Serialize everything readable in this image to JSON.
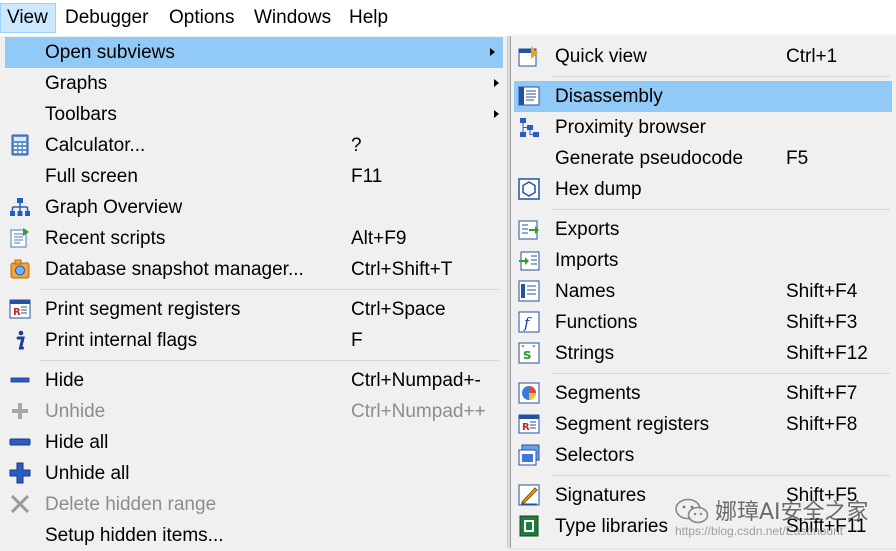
{
  "menubar": {
    "items": [
      {
        "label": "View"
      },
      {
        "label": "Debugger"
      },
      {
        "label": "Options"
      },
      {
        "label": "Windows"
      },
      {
        "label": "Help"
      }
    ]
  },
  "view_menu": {
    "items": [
      {
        "label": "Open subviews",
        "submenu": true,
        "highlighted": true
      },
      {
        "label": "Graphs",
        "submenu": true
      },
      {
        "label": "Toolbars",
        "submenu": true
      },
      {
        "label": "Calculator...",
        "shortcut": "?"
      },
      {
        "label": "Full screen",
        "shortcut": "F11"
      },
      {
        "label": "Graph Overview"
      },
      {
        "label": "Recent scripts",
        "shortcut": "Alt+F9"
      },
      {
        "label": "Database snapshot manager...",
        "shortcut": "Ctrl+Shift+T"
      },
      {
        "label": "Print segment registers",
        "shortcut": "Ctrl+Space"
      },
      {
        "label": "Print internal flags",
        "shortcut": "F"
      },
      {
        "label": "Hide",
        "shortcut": "Ctrl+Numpad+-"
      },
      {
        "label": "Unhide",
        "shortcut": "Ctrl+Numpad++",
        "disabled": true
      },
      {
        "label": "Hide all"
      },
      {
        "label": "Unhide all"
      },
      {
        "label": "Delete hidden range",
        "disabled": true
      },
      {
        "label": "Setup hidden items..."
      }
    ]
  },
  "subviews_menu": {
    "items": [
      {
        "label": "Quick view",
        "shortcut": "Ctrl+1"
      },
      {
        "label": "Disassembly",
        "highlighted": true
      },
      {
        "label": "Proximity browser"
      },
      {
        "label": "Generate pseudocode",
        "shortcut": "F5"
      },
      {
        "label": "Hex dump"
      },
      {
        "label": "Exports"
      },
      {
        "label": "Imports"
      },
      {
        "label": "Names",
        "shortcut": "Shift+F4"
      },
      {
        "label": "Functions",
        "shortcut": "Shift+F3"
      },
      {
        "label": "Strings",
        "shortcut": "Shift+F12"
      },
      {
        "label": "Segments",
        "shortcut": "Shift+F7"
      },
      {
        "label": "Segment registers",
        "shortcut": "Shift+F8"
      },
      {
        "label": "Selectors"
      },
      {
        "label": "Signatures",
        "shortcut": "Shift+F5"
      },
      {
        "label": "Type libraries",
        "shortcut": "Shift+F11"
      }
    ]
  },
  "watermark": {
    "title": "娜璋AI安全之家",
    "url": "https://blog.csdn.net/Eastmount"
  },
  "colors": {
    "highlight": "#91c9f7",
    "menubar_active": "#cce8ff",
    "disabled_text": "#8d8d8d"
  }
}
